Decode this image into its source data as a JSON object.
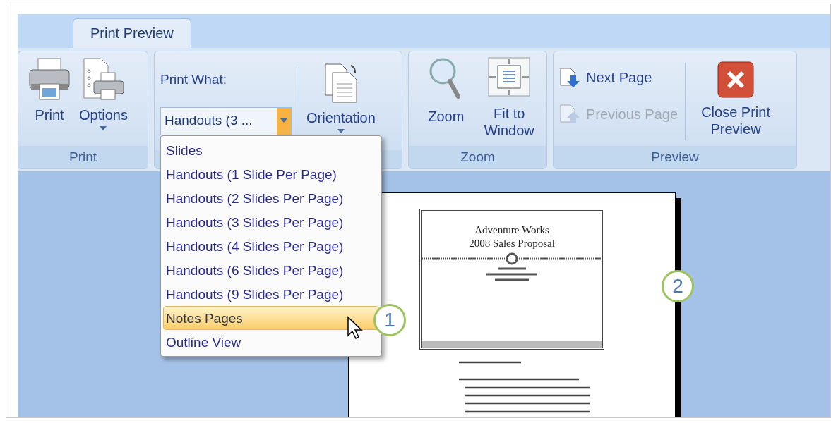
{
  "tabs": [
    {
      "label": "Print Preview",
      "selected": true
    }
  ],
  "ribbon": {
    "print_group": {
      "label": "Print",
      "buttons": [
        {
          "label": "Print",
          "has_menu": false
        },
        {
          "label": "Options",
          "has_menu": true
        }
      ]
    },
    "page_setup_group": {
      "print_what_label": "Print What:",
      "print_what_value": "Handouts (3 ...",
      "orientation": {
        "label": "Orientation",
        "has_menu": true
      }
    },
    "zoom_group": {
      "label": "Zoom",
      "buttons": [
        {
          "label": "Zoom"
        },
        {
          "label": "Fit to Window"
        }
      ]
    },
    "preview_group": {
      "label": "Preview",
      "next": {
        "label": "Next Page",
        "disabled": false
      },
      "previous": {
        "label": "Previous Page",
        "disabled": true
      },
      "close": {
        "label": "Close Print Preview"
      }
    }
  },
  "dropdown": {
    "items": [
      {
        "label": "Slides",
        "selected": false
      },
      {
        "label": "Handouts (1 Slide Per Page)",
        "selected": false
      },
      {
        "label": "Handouts (2 Slides Per Page)",
        "selected": false
      },
      {
        "label": "Handouts (3 Slides Per Page)",
        "selected": false
      },
      {
        "label": "Handouts (4 Slides Per Page)",
        "selected": false
      },
      {
        "label": "Handouts (6 Slides Per Page)",
        "selected": false
      },
      {
        "label": "Handouts (9 Slides Per Page)",
        "selected": false
      },
      {
        "label": "Notes Pages",
        "selected": true
      },
      {
        "label": "Outline View",
        "selected": false
      }
    ]
  },
  "preview_page": {
    "slide_title": "Adventure Works",
    "slide_subtitle": "2008 Sales Proposal"
  },
  "callouts": [
    "1",
    "2"
  ]
}
